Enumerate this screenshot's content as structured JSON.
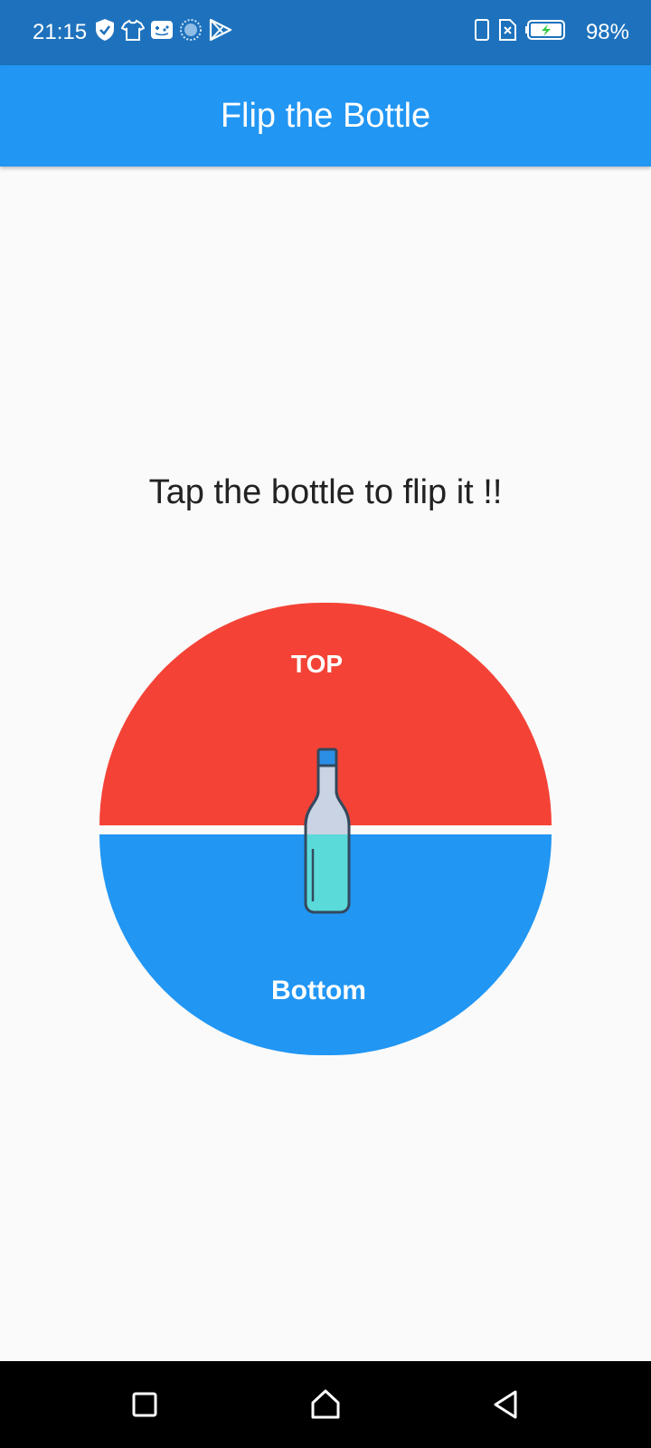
{
  "status_bar": {
    "time": "21:15",
    "battery_percent": "98%",
    "left_icons": [
      "shield-icon",
      "tshirt-icon",
      "gamepad-icon",
      "circle-dots-icon",
      "play-store-icon"
    ],
    "right_icons": [
      "phone-outline-icon",
      "no-sim-icon",
      "battery-charging-icon"
    ]
  },
  "app_bar": {
    "title": "Flip the Bottle",
    "color": "#2196f3"
  },
  "main": {
    "instruction": "Tap the bottle to flip it !!",
    "dial": {
      "top_label": "TOP",
      "bottom_label": "Bottom",
      "top_color": "#f44336",
      "bottom_color": "#2196f3"
    },
    "bottle_icon": "bottle-icon"
  },
  "nav_bar": {
    "buttons": [
      "recent-apps-icon",
      "home-icon",
      "back-icon"
    ]
  }
}
